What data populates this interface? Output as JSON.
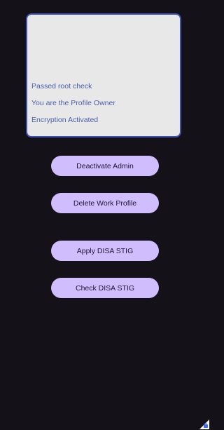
{
  "status_panel": {
    "lines": [
      "Passed root check",
      "You are the Profile Owner",
      "Encryption Activated"
    ]
  },
  "buttons": {
    "deactivate_admin": "Deactivate Admin",
    "delete_work_profile": "Delete Work Profile",
    "apply_disa_stig": "Apply DISA STIG",
    "check_disa_stig": "Check DISA STIG"
  },
  "colors": {
    "background": "#141218",
    "panel_background": "#e8e8e8",
    "panel_border": "#3f51b5",
    "panel_text": "#4a5ea8",
    "button_fill": "#cfbdfe",
    "button_text": "#1d1630",
    "corner_icon": "#3d6ff0"
  },
  "icons": {
    "corner": "work-profile-badge-icon"
  }
}
